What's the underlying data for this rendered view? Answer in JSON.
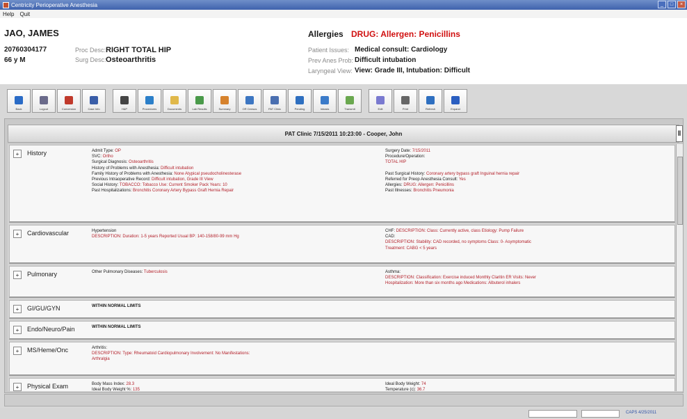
{
  "window": {
    "title": "Centricity Perioperative Anesthesia"
  },
  "menu": [
    "Help",
    "Quit"
  ],
  "patient": {
    "name": "JAO, JAMES",
    "id": "20760304177",
    "age_sex": "66 y M",
    "proc_desc_label": "Proc Desc:",
    "proc_desc": "RIGHT TOTAL HIP",
    "surg_desc_label": "Surg Desc:",
    "surg_desc": "Osteoarthritis",
    "allergies_label": "Allergies",
    "allergies": "DRUG: Allergen: Penicillins",
    "patient_issues_label": "Patient Issues:",
    "patient_issues": "Medical consult: Cardiology",
    "prev_anes_label": "Prev Anes Prob:",
    "prev_anes": "Difficult intubation",
    "laryngeal_label": "Laryngeal View:",
    "laryngeal": "View: Grade III,  Intubation: Difficult"
  },
  "toolbar": [
    {
      "label": "Back",
      "icon": "back-icon",
      "color": "#2a6bc6"
    },
    {
      "label": "Logout",
      "icon": "logout-icon",
      "color": "#6a6a8a"
    },
    {
      "label": "Conversion",
      "icon": "conversion-icon",
      "color": "#c0392b"
    },
    {
      "label": "Case Info",
      "icon": "case-info-icon",
      "color": "#3a5ea8"
    },
    {
      "label": "H&P",
      "icon": "pen-icon",
      "color": "#444"
    },
    {
      "label": "Procedures",
      "icon": "procedures-icon",
      "color": "#2b7fc9"
    },
    {
      "label": "Documents",
      "icon": "documents-icon",
      "color": "#e0b84a"
    },
    {
      "label": "Lab Results",
      "icon": "lab-results-icon",
      "color": "#4a9a4a"
    },
    {
      "label": "Summary",
      "icon": "summary-icon",
      "color": "#d6822d"
    },
    {
      "label": "OR Census",
      "icon": "or-census-icon",
      "color": "#3c76c2"
    },
    {
      "label": "PAT Clinic",
      "icon": "pat-clinic-icon",
      "color": "#4a6fb0"
    },
    {
      "label": "Pending",
      "icon": "pending-icon",
      "color": "#2e6fc0"
    },
    {
      "label": "Inbasis",
      "icon": "inbasis-icon",
      "color": "#3b7bc9"
    },
    {
      "label": "Transmit",
      "icon": "transmit-icon",
      "color": "#6aa84f"
    },
    {
      "label": "Edit",
      "icon": "edit-icon",
      "color": "#7a7ad0"
    },
    {
      "label": "Print",
      "icon": "print-icon",
      "color": "#666"
    },
    {
      "label": "Refresh",
      "icon": "refresh-icon",
      "color": "#2e6fc0"
    },
    {
      "label": "Expand",
      "icon": "expand-icon",
      "color": "#2a5ec0"
    }
  ],
  "note_header": "PAT Clinic 7/15/2011 10:23:00 - Cooper, John",
  "sections": [
    {
      "name": "History",
      "left": [
        [
          {
            "t": "Admit Type:  "
          },
          {
            "t": "OP",
            "r": true
          }
        ],
        [
          {
            "t": "SVC:  "
          },
          {
            "t": "Ortho",
            "r": true
          }
        ],
        [
          {
            "t": "Surgical Diagnosis:  "
          },
          {
            "t": "Osteoarthritis",
            "r": true
          }
        ],
        [
          {
            "t": "History of Problems with Anesthesia:  "
          },
          {
            "t": "Difficult intubation",
            "r": true
          }
        ],
        [
          {
            "t": "Family History of Problems with Anesthesia:  "
          },
          {
            "t": "None Atypical pseudocholinesterase",
            "r": true
          }
        ],
        [
          {
            "t": "Previous Intraoperative Record:  "
          },
          {
            "t": "Difficult intubation, Grade III View",
            "r": true
          }
        ],
        [
          {
            "t": "Social History:  "
          },
          {
            "t": "TOBACCO: Tobacco Use: Current Smoker   Pack Years: 10",
            "r": true
          }
        ],
        [
          {
            "t": "Past Hospitalizations:  "
          },
          {
            "t": "Bronchitis Coronary Artery Bypass Graft Hernia Repair",
            "r": true
          }
        ]
      ],
      "right": [
        [
          {
            "t": "Surgery Date:  "
          },
          {
            "t": "7/15/2011",
            "r": true
          }
        ],
        [
          {
            "t": "Procedure/Operation:"
          }
        ],
        [
          {
            "t": "TOTAL HIP",
            "r": true
          }
        ],
        [
          {
            "t": ""
          }
        ],
        [
          {
            "t": "Past Surgical History:  "
          },
          {
            "t": "Coronary artery bypass graft Inguinal hernia repair",
            "r": true
          }
        ],
        [
          {
            "t": "Referred for Preop Anesthesia Consult:  "
          },
          {
            "t": "Yes",
            "r": true
          }
        ],
        [
          {
            "t": "Allergies:  "
          },
          {
            "t": "DRUG: Allergen: Penicillins",
            "r": true
          }
        ],
        [
          {
            "t": "Past Illnesses:  "
          },
          {
            "t": "Bronchitis Pneumonia",
            "r": true
          }
        ]
      ]
    },
    {
      "name": "Cardiovascular",
      "left": [
        [
          {
            "t": "Hypertension"
          }
        ],
        [
          {
            "t": "DESCRIPTION: Duration: 1-5 years    Reported Usual BP: 140-158/80-99 mm Hg",
            "r": true
          }
        ]
      ],
      "right": [
        [
          {
            "t": "CHF:  "
          },
          {
            "t": "DESCRIPTION: Class: Currently active, class     Etiology: Pump Failure",
            "r": true
          }
        ],
        [
          {
            "t": "CAD:"
          }
        ],
        [
          {
            "t": "DESCRIPTION: Stability: CAD recorded, no symptoms     Class: 0- Asymptomatic",
            "r": true
          }
        ],
        [
          {
            "t": "Treatment: CABG < 5 years",
            "r": true
          }
        ]
      ]
    },
    {
      "name": "Pulmonary",
      "left": [
        [
          {
            "t": "Other Pulmonary Diseases:  "
          },
          {
            "t": "Tuberculosis",
            "r": true
          }
        ]
      ],
      "right": [
        [
          {
            "t": "Asthma:"
          }
        ],
        [
          {
            "t": "DESCRIPTION: Classification: Exercise induced Monthly Claritin    ER Visits: Never",
            "r": true
          }
        ],
        [
          {
            "t": "Hospitalization: More than six months ago    Medications: Albuterol inhalers",
            "r": true
          }
        ]
      ]
    },
    {
      "name": "GI/GU/GYN",
      "left": [
        [
          {
            "t": "WITHIN NORMAL LIMITS",
            "b": true
          }
        ]
      ],
      "right": []
    },
    {
      "name": "Endo/Neuro/Pain",
      "left": [
        [
          {
            "t": "WITHIN NORMAL LIMITS",
            "b": true
          }
        ]
      ],
      "right": []
    },
    {
      "name": "MS/Heme/Onc",
      "left": [
        [
          {
            "t": "Arthritis:"
          }
        ],
        [
          {
            "t": "DESCRIPTION: Type: Rheumatoid    Cardiopulmonary Involvement: No    Manifestations:",
            "r": true
          }
        ],
        [
          {
            "t": "Arthralgia",
            "r": true
          }
        ]
      ],
      "right": []
    },
    {
      "name": "Physical Exam",
      "left": [
        [
          {
            "t": "Body Mass Index:  "
          },
          {
            "t": "28.3",
            "r": true
          }
        ],
        [
          {
            "t": "Ideal Body Weight %:  "
          },
          {
            "t": "135",
            "r": true
          }
        ]
      ],
      "right": [
        [
          {
            "t": "Ideal Body Weight:  "
          },
          {
            "t": "74",
            "r": true
          }
        ],
        [
          {
            "t": "Temperature (c):  "
          },
          {
            "t": "36.7",
            "r": true
          }
        ]
      ]
    }
  ],
  "statusbar": {
    "right_text": "CAPS  4/25/2011"
  }
}
